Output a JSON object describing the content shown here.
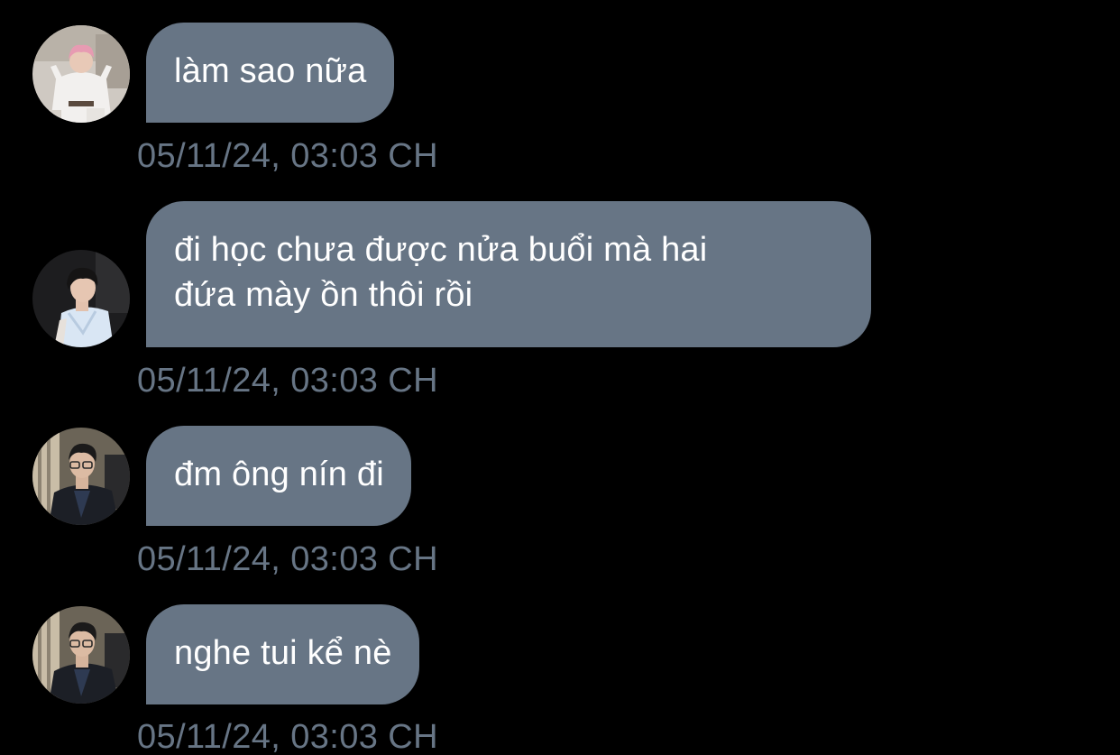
{
  "messages": [
    {
      "avatar": "avatar-pink-hair-white-outfit",
      "text": "làm sao nữa",
      "timestamp": "05/11/24, 03:03 CH"
    },
    {
      "avatar": "avatar-dark-hair-blue-shirt",
      "text": "đi học chưa được nửa buổi mà hai\nđứa mày ồn thôi rồi",
      "timestamp": "05/11/24, 03:03 CH"
    },
    {
      "avatar": "avatar-glasses-dark-suit",
      "text": "đm ông nín đi",
      "timestamp": "05/11/24, 03:03 CH"
    },
    {
      "avatar": "avatar-glasses-dark-suit",
      "text": "nghe tui kể nè",
      "timestamp": "05/11/24, 03:03 CH"
    }
  ],
  "colors": {
    "background": "#000000",
    "bubble": "#677585",
    "bubble_text": "#ffffff",
    "timestamp_text": "#677585"
  }
}
